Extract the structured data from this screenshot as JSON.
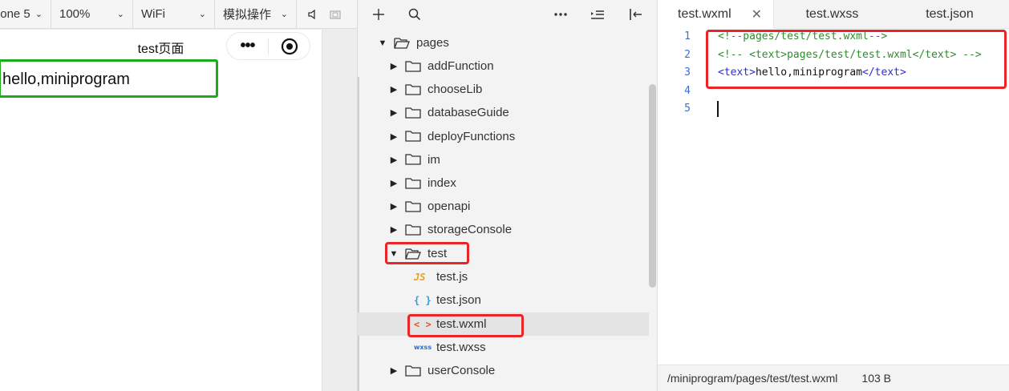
{
  "simulator": {
    "device": "one 5",
    "zoom": "100%",
    "network": "WiFi",
    "operation": "模拟操作",
    "page_title": "test页面",
    "capsule_dots": "•••",
    "content_text": "hello,miniprogram"
  },
  "file_tree": {
    "root": "pages",
    "folders_before": [
      "addFunction",
      "chooseLib",
      "databaseGuide",
      "deployFunctions",
      "im",
      "index",
      "openapi",
      "storageConsole"
    ],
    "open_folder": "test",
    "files": [
      {
        "name": "test.js",
        "icon": "JS"
      },
      {
        "name": "test.json",
        "icon": "{ }"
      },
      {
        "name": "test.wxml",
        "icon": "< >"
      },
      {
        "name": "test.wxss",
        "icon": "wxss"
      }
    ],
    "folders_after": [
      "userConsole"
    ]
  },
  "editor": {
    "tabs": [
      "test.wxml",
      "test.wxss",
      "test.json"
    ],
    "close_glyph": "✕",
    "line_numbers": [
      "1",
      "2",
      "3",
      "4",
      "5"
    ],
    "lines": {
      "l1": "<!--pages/test/test.wxml-->",
      "l2": "<!-- <text>pages/test/test.wxml</text> -->",
      "l3_open": "<text>",
      "l3_text": "hello,miniprogram",
      "l3_close": "</text>"
    },
    "status_path": "/miniprogram/pages/test/test.wxml",
    "status_size": "103 B"
  },
  "colors": {
    "highlight_red": "#e8262a",
    "highlight_green": "#1aad19",
    "comment": "#2e8b2e",
    "tag": "#2b2bd6"
  }
}
